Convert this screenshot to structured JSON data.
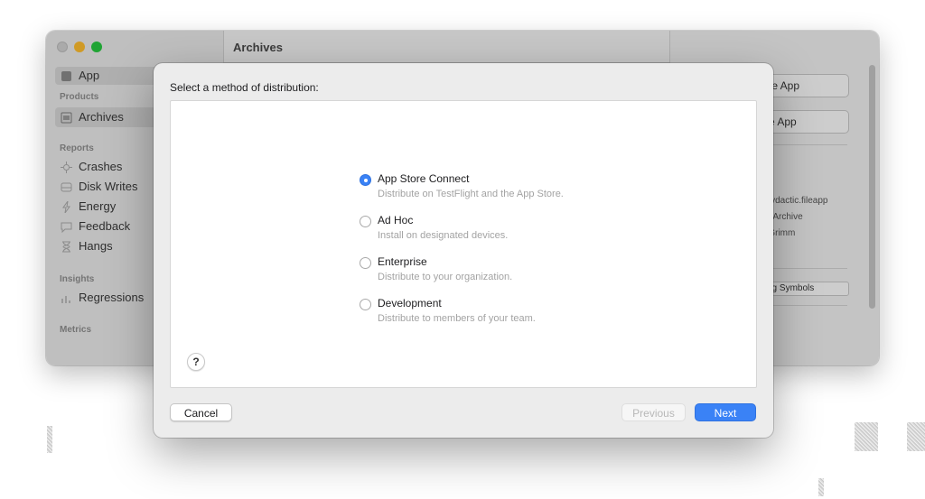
{
  "background_window": {
    "title": "Archives",
    "sidebar": {
      "top_item": "App",
      "products_header": "Products",
      "archives_item": "Archives",
      "reports_header": "Reports",
      "reports_items": [
        "Crashes",
        "Disk Writes",
        "Energy",
        "Feedback",
        "Hangs"
      ],
      "insights_header": "Insights",
      "insights_items": [
        "Regressions"
      ],
      "metrics_header": "Metrics"
    },
    "inspector": {
      "buttons": [
        "te App",
        "e App"
      ],
      "text_lines": [
        "l",
        "devdactic.fileapp",
        "pp Archive",
        "n Grimm",
        "s"
      ],
      "symbols_button": "ug Symbols"
    }
  },
  "sheet": {
    "title": "Select a method of distribution:",
    "options": [
      {
        "title": "App Store Connect",
        "description": "Distribute on TestFlight and the App Store.",
        "selected": true
      },
      {
        "title": "Ad Hoc",
        "description": "Install on designated devices.",
        "selected": false
      },
      {
        "title": "Enterprise",
        "description": "Distribute to your organization.",
        "selected": false
      },
      {
        "title": "Development",
        "description": "Distribute to members of your team.",
        "selected": false
      }
    ],
    "help_label": "?",
    "cancel_label": "Cancel",
    "previous_label": "Previous",
    "next_label": "Next"
  },
  "colors": {
    "accent": "#3a82f6",
    "traffic_minimize": "#febc2e",
    "traffic_maximize": "#28c840",
    "disabled_text": "#b8b8b8"
  }
}
